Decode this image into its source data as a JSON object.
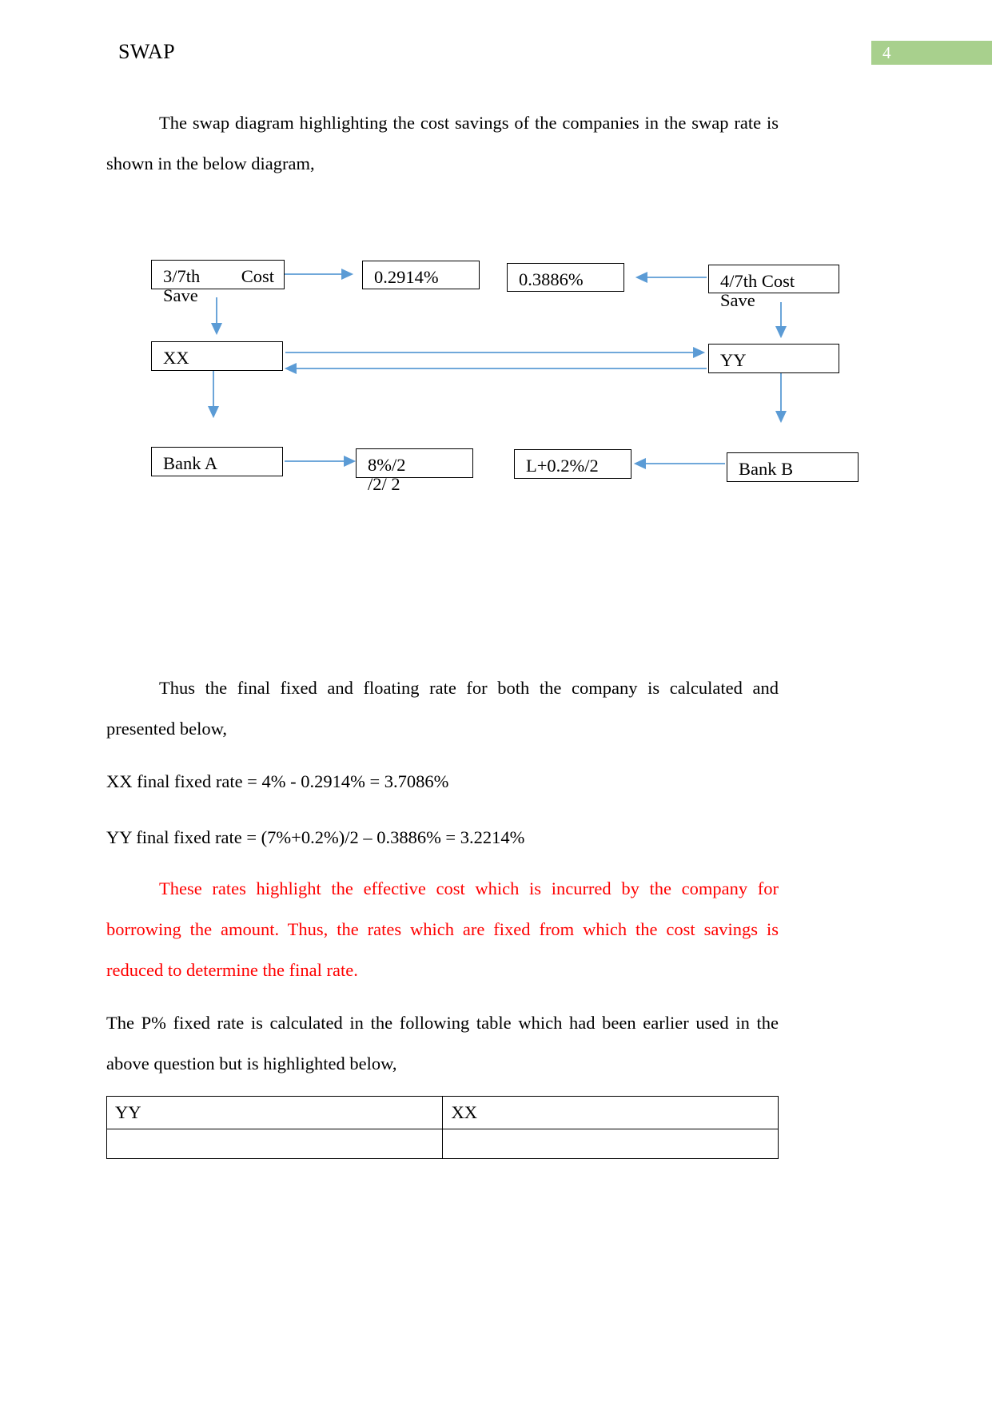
{
  "header": {
    "title": "SWAP",
    "page_number": "4",
    "badge_color": "#a8d08d"
  },
  "paragraphs": {
    "intro": "The swap diagram highlighting the cost savings of the companies in the swap rate is shown in the below diagram,",
    "thus_final": "Thus the final fixed and floating rate for both the company is calculated and presented below,",
    "xx_rate": "XX final fixed rate = 4% - 0.2914% = 3.7086%",
    "yy_rate": "YY final fixed rate = (7%+0.2%)/2 – 0.3886% = 3.2214%",
    "red_note": "These rates highlight the effective cost which is incurred by the company for borrowing the amount. Thus, the rates which are fixed from which the cost savings is reduced to determine the final rate.",
    "p_rate": "The P% fixed rate is calculated in the following table which had been earlier used in the above question but is highlighted below,",
    "red_color": "#ff0000"
  },
  "diagram": {
    "arrow_color": "#5b9bd5",
    "boxes": {
      "cost_save_left": {
        "line1": "3/7th",
        "line2": "Cost",
        "overflow": "Save"
      },
      "rate_left": "0.2914%",
      "rate_right": "0.3886%",
      "cost_save_right": {
        "line1": "4/7th Cost",
        "overflow": "Save"
      },
      "company_left": "XX",
      "company_right": "YY",
      "bank_left": "Bank A",
      "fixed_left": {
        "line1": "8%/2",
        "overflow": "/2/ 2"
      },
      "float_right": "L+0.2%/2",
      "bank_right": "Bank B"
    }
  },
  "table": {
    "headers": [
      "YY",
      "XX"
    ],
    "rows": [
      [
        "",
        ""
      ]
    ]
  }
}
